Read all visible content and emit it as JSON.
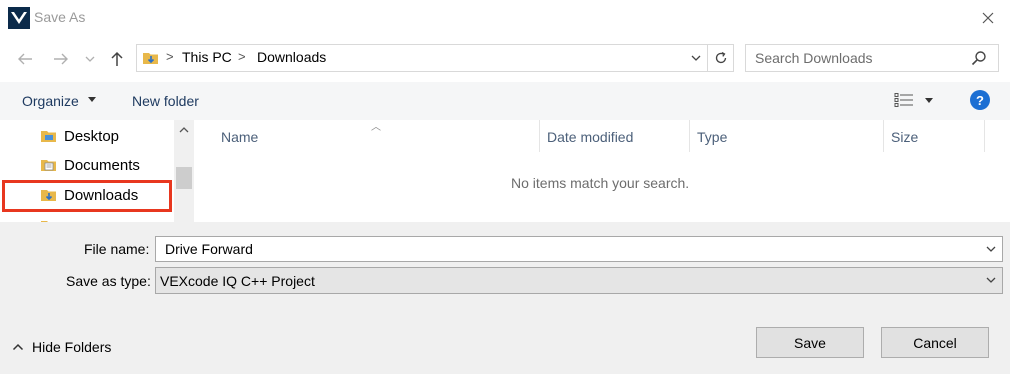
{
  "window": {
    "title": "Save As"
  },
  "nav": {
    "path": [
      "This PC",
      "Downloads"
    ],
    "search_placeholder": "Search Downloads"
  },
  "toolbar": {
    "organize_label": "Organize",
    "new_folder_label": "New folder",
    "help_label": "?"
  },
  "sidebar": {
    "items": [
      {
        "label": "Desktop",
        "icon": "desktop-folder-icon"
      },
      {
        "label": "Documents",
        "icon": "documents-folder-icon"
      },
      {
        "label": "Downloads",
        "icon": "downloads-folder-icon",
        "selected": true
      }
    ]
  },
  "list": {
    "columns": [
      "Name",
      "Date modified",
      "Type",
      "Size"
    ],
    "empty_message": "No items match your search."
  },
  "form": {
    "file_name_label": "File name:",
    "file_name_value": "Drive Forward",
    "save_type_label": "Save as type:",
    "save_type_value": "VEXcode IQ C++ Project"
  },
  "footer": {
    "hide_folders_label": "Hide Folders",
    "save_label": "Save",
    "cancel_label": "Cancel"
  },
  "colors": {
    "accent": "#1c6fd3",
    "highlight": "#e8371f",
    "folder": "#e8b84a"
  }
}
